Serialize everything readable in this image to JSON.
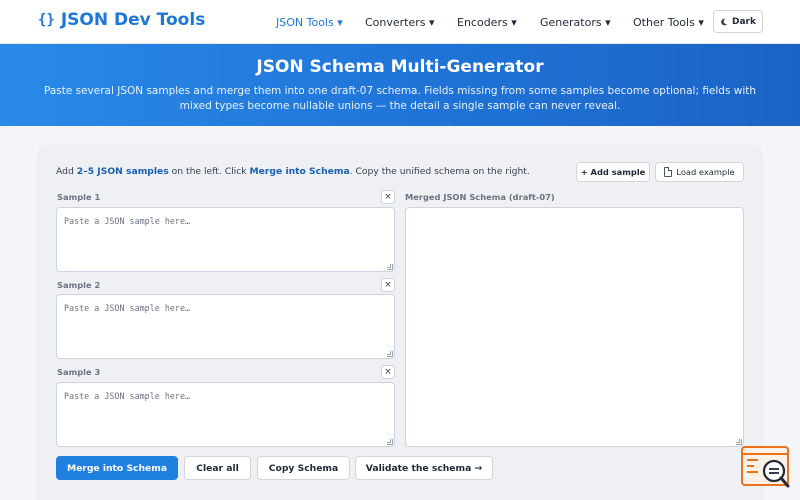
{
  "header": {
    "brand": "JSON Dev Tools",
    "brand_icon": "{}",
    "nav": [
      {
        "label": "JSON Tools ▾",
        "active": true
      },
      {
        "label": "Converters ▾",
        "active": false
      },
      {
        "label": "Encoders ▾",
        "active": false
      },
      {
        "label": "Generators ▾",
        "active": false
      },
      {
        "label": "Other Tools ▾",
        "active": false
      }
    ],
    "theme_toggle": "Dark",
    "theme_icon": "moon-icon"
  },
  "hero": {
    "title": "JSON Schema Multi-Generator",
    "subtitle": "Paste several JSON samples and merge them into one draft-07 schema. Fields missing from some samples become optional; fields with mixed types become nullable unions — the detail a single sample can never reveal."
  },
  "tool": {
    "instruction_prefix": "Add ",
    "instruction_bold1": "2–5 JSON samples",
    "instruction_mid": " on the left. Click ",
    "instruction_bold2": "Merge into Schema",
    "instruction_suffix": ". Copy the unified schema on the right.",
    "add_sample": "+ Add sample",
    "load_example": "Load example",
    "samples": [
      {
        "label": "Sample 1",
        "placeholder": "Paste a JSON sample here…",
        "value": ""
      },
      {
        "label": "Sample 2",
        "placeholder": "Paste a JSON sample here…",
        "value": ""
      },
      {
        "label": "Sample 3",
        "placeholder": "Paste a JSON sample here…",
        "value": ""
      }
    ],
    "remove_symbol": "×",
    "merged_label": "Merged JSON Schema (draft-07)",
    "merged_value": "",
    "buttons": {
      "merge": "Merge into Schema",
      "clear": "Clear all",
      "copy": "Copy Schema",
      "validate": "Validate the schema →"
    }
  },
  "colors": {
    "accent": "#1f80e0",
    "hero_start": "#2a8ae8",
    "hero_end": "#1a63c4",
    "widget": "#e8731c"
  }
}
